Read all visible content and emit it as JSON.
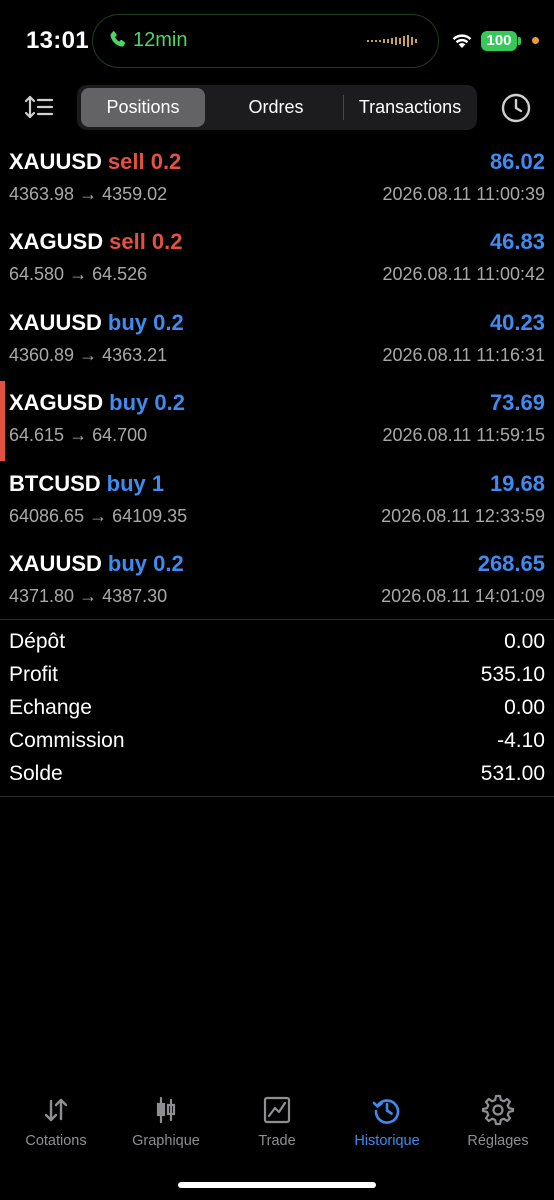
{
  "status_bar": {
    "time": "13:01",
    "call_duration": "12min",
    "battery": "100",
    "colors": {
      "call_green": "#4ad761",
      "battery_green": "#36c95a",
      "privacy_orange": "#f19a33"
    }
  },
  "header": {
    "tabs": [
      {
        "label": "Positions",
        "active": true
      },
      {
        "label": "Ordres",
        "active": false
      },
      {
        "label": "Transactions",
        "active": false
      }
    ],
    "left_icon": "sort-icon",
    "right_icon": "clock-icon"
  },
  "trades": [
    {
      "symbol": "XAUUSD",
      "direction": "sell 0.2",
      "type": "sell",
      "profit": "86.02",
      "open_price": "4363.98",
      "close_price": "4359.02",
      "datetime": "2026.08.11 11:00:39",
      "highlighted": false
    },
    {
      "symbol": "XAGUSD",
      "direction": "sell 0.2",
      "type": "sell",
      "profit": "46.83",
      "open_price": "64.580",
      "close_price": "64.526",
      "datetime": "2026.08.11 11:00:42",
      "highlighted": false
    },
    {
      "symbol": "XAUUSD",
      "direction": "buy 0.2",
      "type": "buy",
      "profit": "40.23",
      "open_price": "4360.89",
      "close_price": "4363.21",
      "datetime": "2026.08.11 11:16:31",
      "highlighted": false
    },
    {
      "symbol": "XAGUSD",
      "direction": "buy 0.2",
      "type": "buy",
      "profit": "73.69",
      "open_price": "64.615",
      "close_price": "64.700",
      "datetime": "2026.08.11 11:59:15",
      "highlighted": true
    },
    {
      "symbol": "BTCUSD",
      "direction": "buy 1",
      "type": "buy",
      "profit": "19.68",
      "open_price": "64086.65",
      "close_price": "64109.35",
      "datetime": "2026.08.11 12:33:59",
      "highlighted": false
    },
    {
      "symbol": "XAUUSD",
      "direction": "buy 0.2",
      "type": "buy",
      "profit": "268.65",
      "open_price": "4371.80",
      "close_price": "4387.30",
      "datetime": "2026.08.11 14:01:09",
      "highlighted": false
    }
  ],
  "arrow": "→",
  "summary": [
    {
      "label": "Dépôt",
      "value": "0.00"
    },
    {
      "label": "Profit",
      "value": "535.10"
    },
    {
      "label": "Echange",
      "value": "0.00"
    },
    {
      "label": "Commission",
      "value": "-4.10"
    },
    {
      "label": "Solde",
      "value": "531.00"
    }
  ],
  "tabbar": [
    {
      "label": "Cotations",
      "icon": "arrows-updown-icon",
      "active": false
    },
    {
      "label": "Graphique",
      "icon": "candlestick-icon",
      "active": false
    },
    {
      "label": "Trade",
      "icon": "trade-chart-icon",
      "active": false
    },
    {
      "label": "Historique",
      "icon": "history-icon",
      "active": true
    },
    {
      "label": "Réglages",
      "icon": "gear-icon",
      "active": false
    }
  ],
  "colors": {
    "sell": "#e15241",
    "buy": "#3f8bf0",
    "profit": "#3f8bf0",
    "secondary_text": "#a8a8aa",
    "tab_active": "#3f8bf0",
    "tab_inactive": "#8e8e93"
  }
}
